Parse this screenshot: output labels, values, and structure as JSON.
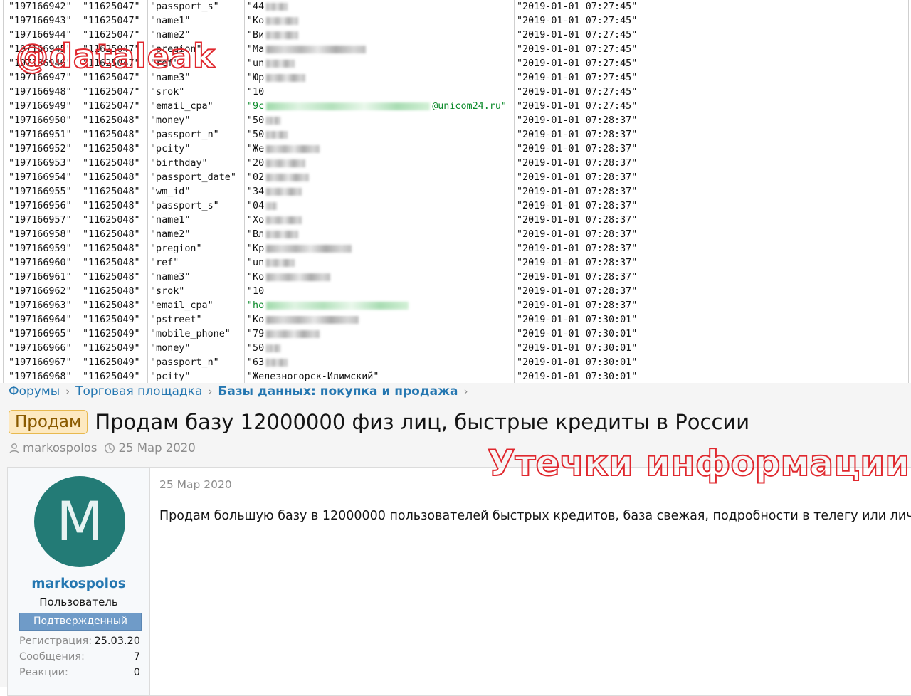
{
  "dump": {
    "rows": [
      {
        "id": "\"197166942\"",
        "uid": "\"11625047\"",
        "key": "\"passport_s\"",
        "val": "\"44",
        "blur": 30,
        "date": "\"2019-01-01 07:27:45\""
      },
      {
        "id": "\"197166943\"",
        "uid": "\"11625047\"",
        "key": "\"name1\"",
        "val": "\"Ко",
        "blur": 45,
        "date": "\"2019-01-01 07:27:45\""
      },
      {
        "id": "\"197166944\"",
        "uid": "\"11625047\"",
        "key": "\"name2\"",
        "val": "\"Ви",
        "blur": 45,
        "date": "\"2019-01-01 07:27:45\""
      },
      {
        "id": "\"197166945\"",
        "uid": "\"11625047\"",
        "key": "\"pregion\"",
        "val": "\"Ма",
        "blur": 140,
        "date": "\"2019-01-01 07:27:45\""
      },
      {
        "id": "\"197166946\"",
        "uid": "\"11625047\"",
        "key": "\"ref\"",
        "val": "\"un",
        "blur": 40,
        "date": "\"2019-01-01 07:27:45\""
      },
      {
        "id": "\"197166947\"",
        "uid": "\"11625047\"",
        "key": "\"name3\"",
        "val": "\"Юр",
        "blur": 55,
        "date": "\"2019-01-01 07:27:45\""
      },
      {
        "id": "\"197166948\"",
        "uid": "\"11625047\"",
        "key": "\"srok\"",
        "val": "\"10",
        "blur": 0,
        "date": "\"2019-01-01 07:27:45\""
      },
      {
        "id": "\"197166949\"",
        "uid": "\"11625047\"",
        "key": "\"email_cpa\"",
        "val": "\"9c",
        "blur": 230,
        "tail": "@unicom24.ru\"",
        "green": true,
        "date": "\"2019-01-01 07:27:45\""
      },
      {
        "id": "\"197166950\"",
        "uid": "\"11625048\"",
        "key": "\"money\"",
        "val": "\"50",
        "blur": 20,
        "date": "\"2019-01-01 07:28:37\""
      },
      {
        "id": "\"197166951\"",
        "uid": "\"11625048\"",
        "key": "\"passport_n\"",
        "val": "\"50",
        "blur": 30,
        "date": "\"2019-01-01 07:28:37\""
      },
      {
        "id": "\"197166952\"",
        "uid": "\"11625048\"",
        "key": "\"pcity\"",
        "val": "\"Же",
        "blur": 75,
        "date": "\"2019-01-01 07:28:37\""
      },
      {
        "id": "\"197166953\"",
        "uid": "\"11625048\"",
        "key": "\"birthday\"",
        "val": "\"20",
        "blur": 55,
        "date": "\"2019-01-01 07:28:37\""
      },
      {
        "id": "\"197166954\"",
        "uid": "\"11625048\"",
        "key": "\"passport_date\"",
        "val": "\"02",
        "blur": 60,
        "date": "\"2019-01-01 07:28:37\""
      },
      {
        "id": "\"197166955\"",
        "uid": "\"11625048\"",
        "key": "\"wm_id\"",
        "val": "\"34",
        "blur": 50,
        "date": "\"2019-01-01 07:28:37\""
      },
      {
        "id": "\"197166956\"",
        "uid": "\"11625048\"",
        "key": "\"passport_s\"",
        "val": "\"04",
        "blur": 15,
        "date": "\"2019-01-01 07:28:37\""
      },
      {
        "id": "\"197166957\"",
        "uid": "\"11625048\"",
        "key": "\"name1\"",
        "val": "\"Хо",
        "blur": 50,
        "date": "\"2019-01-01 07:28:37\""
      },
      {
        "id": "\"197166958\"",
        "uid": "\"11625048\"",
        "key": "\"name2\"",
        "val": "\"Вл",
        "blur": 45,
        "date": "\"2019-01-01 07:28:37\""
      },
      {
        "id": "\"197166959\"",
        "uid": "\"11625048\"",
        "key": "\"pregion\"",
        "val": "\"Кр",
        "blur": 120,
        "date": "\"2019-01-01 07:28:37\""
      },
      {
        "id": "\"197166960\"",
        "uid": "\"11625048\"",
        "key": "\"ref\"",
        "val": "\"un",
        "blur": 40,
        "date": "\"2019-01-01 07:28:37\""
      },
      {
        "id": "\"197166961\"",
        "uid": "\"11625048\"",
        "key": "\"name3\"",
        "val": "\"Ко",
        "blur": 90,
        "date": "\"2019-01-01 07:28:37\""
      },
      {
        "id": "\"197166962\"",
        "uid": "\"11625048\"",
        "key": "\"srok\"",
        "val": "\"10",
        "blur": 0,
        "date": "\"2019-01-01 07:28:37\""
      },
      {
        "id": "\"197166963\"",
        "uid": "\"11625048\"",
        "key": "\"email_cpa\"",
        "val": "\"ho",
        "blur": 200,
        "green": true,
        "date": "\"2019-01-01 07:28:37\""
      },
      {
        "id": "\"197166964\"",
        "uid": "\"11625049\"",
        "key": "\"pstreet\"",
        "val": "\"Ко",
        "blur": 130,
        "date": "\"2019-01-01 07:30:01\""
      },
      {
        "id": "\"197166965\"",
        "uid": "\"11625049\"",
        "key": "\"mobile_phone\"",
        "val": "\"79",
        "blur": 75,
        "date": "\"2019-01-01 07:30:01\""
      },
      {
        "id": "\"197166966\"",
        "uid": "\"11625049\"",
        "key": "\"money\"",
        "val": "\"50",
        "blur": 20,
        "date": "\"2019-01-01 07:30:01\""
      },
      {
        "id": "\"197166967\"",
        "uid": "\"11625049\"",
        "key": "\"passport_n\"",
        "val": "\"63",
        "blur": 30,
        "date": "\"2019-01-01 07:30:01\""
      },
      {
        "id": "\"197166968\"",
        "uid": "\"11625049\"",
        "key": "\"pcity\"",
        "val": "\"Железногорск-Илимский\"",
        "blur": 0,
        "date": "\"2019-01-01 07:30:01\""
      }
    ]
  },
  "watermarks": {
    "top": "@dataleak",
    "bottom": "Утечки информации"
  },
  "breadcrumb": [
    {
      "label": "Форумы",
      "strong": false
    },
    {
      "label": "Торговая площадка",
      "strong": false
    },
    {
      "label": "Базы данных: покупка и продажа",
      "strong": true
    }
  ],
  "thread": {
    "prefix": "Продам",
    "title": "Продам базу 12000000 физ лиц, быстрые кредиты в России",
    "author": "markospolos",
    "date": "25 Мар 2020"
  },
  "post": {
    "date": "25 Мар 2020",
    "body": "Продам большую базу в 12000000 пользователей быстрых кредитов, база свежая, подробности в телегу или личку"
  },
  "user": {
    "avatar_letter": "M",
    "avatar_color": "#237b76",
    "name": "markospolos",
    "title": "Пользователь",
    "banner": "Подтвержденный",
    "stats": [
      {
        "label": "Регистрация:",
        "value": "25.03.20"
      },
      {
        "label": "Сообщения:",
        "value": "7"
      },
      {
        "label": "Реакции:",
        "value": "0"
      }
    ]
  },
  "icons": [
    "user-icon",
    "clock-icon",
    "chevron-right-icon"
  ]
}
